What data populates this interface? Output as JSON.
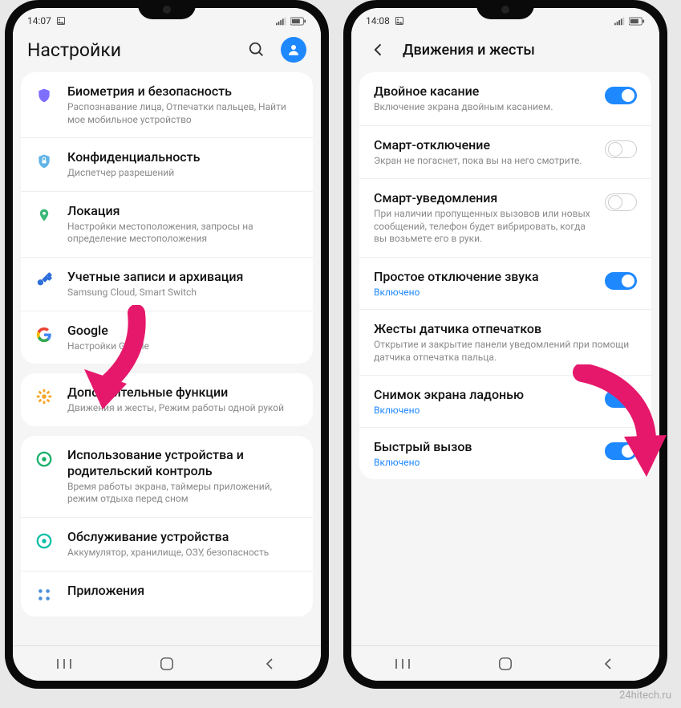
{
  "watermark": "24hitech.ru",
  "phone_left": {
    "status_time": "14:07",
    "header_title": "Настройки",
    "items": [
      {
        "title": "Биометрия и безопасность",
        "desc": "Распознавание лица, Отпечатки пальцев, Найти мое мобильное устройство"
      },
      {
        "title": "Конфиденциальность",
        "desc": "Диспетчер разрешений"
      },
      {
        "title": "Локация",
        "desc": "Настройки местоположения, запросы на определение местоположения"
      },
      {
        "title": "Учетные записи и архивация",
        "desc": "Samsung Cloud, Smart Switch"
      },
      {
        "title": "Google",
        "desc": "Настройки Google"
      },
      {
        "title": "Дополнительные функции",
        "desc": "Движения и жесты, Режим работы одной рукой"
      },
      {
        "title": "Использование устройства и родительский контроль",
        "desc": "Время работы экрана, таймеры приложений, режим отдыха перед сном"
      },
      {
        "title": "Обслуживание устройства",
        "desc": "Аккумулятор, хранилище, ОЗУ, безопасность"
      },
      {
        "title": "Приложения",
        "desc": ""
      }
    ]
  },
  "phone_right": {
    "status_time": "14:08",
    "header_title": "Движения и жесты",
    "items": [
      {
        "title": "Двойное касание",
        "desc": "Включение экрана двойным касанием.",
        "on": true
      },
      {
        "title": "Смарт-отключение",
        "desc": "Экран не погаснет, пока вы на него смотрите.",
        "on": false
      },
      {
        "title": "Смарт-уведомления",
        "desc": "При наличии пропущенных вызовов или новых сообщений, телефон будет вибрировать, когда вы возьмете его в руки.",
        "on": false
      },
      {
        "title": "Простое отключение звука",
        "status": "Включено",
        "on": true
      },
      {
        "title": "Жесты датчика отпечатков",
        "desc": "Открытие и закрытие панели уведомлений при помощи датчика отпечатка пальца."
      },
      {
        "title": "Снимок экрана ладонью",
        "status": "Включено",
        "on": true
      },
      {
        "title": "Быстрый вызов",
        "status": "Включено",
        "on": true
      }
    ]
  }
}
